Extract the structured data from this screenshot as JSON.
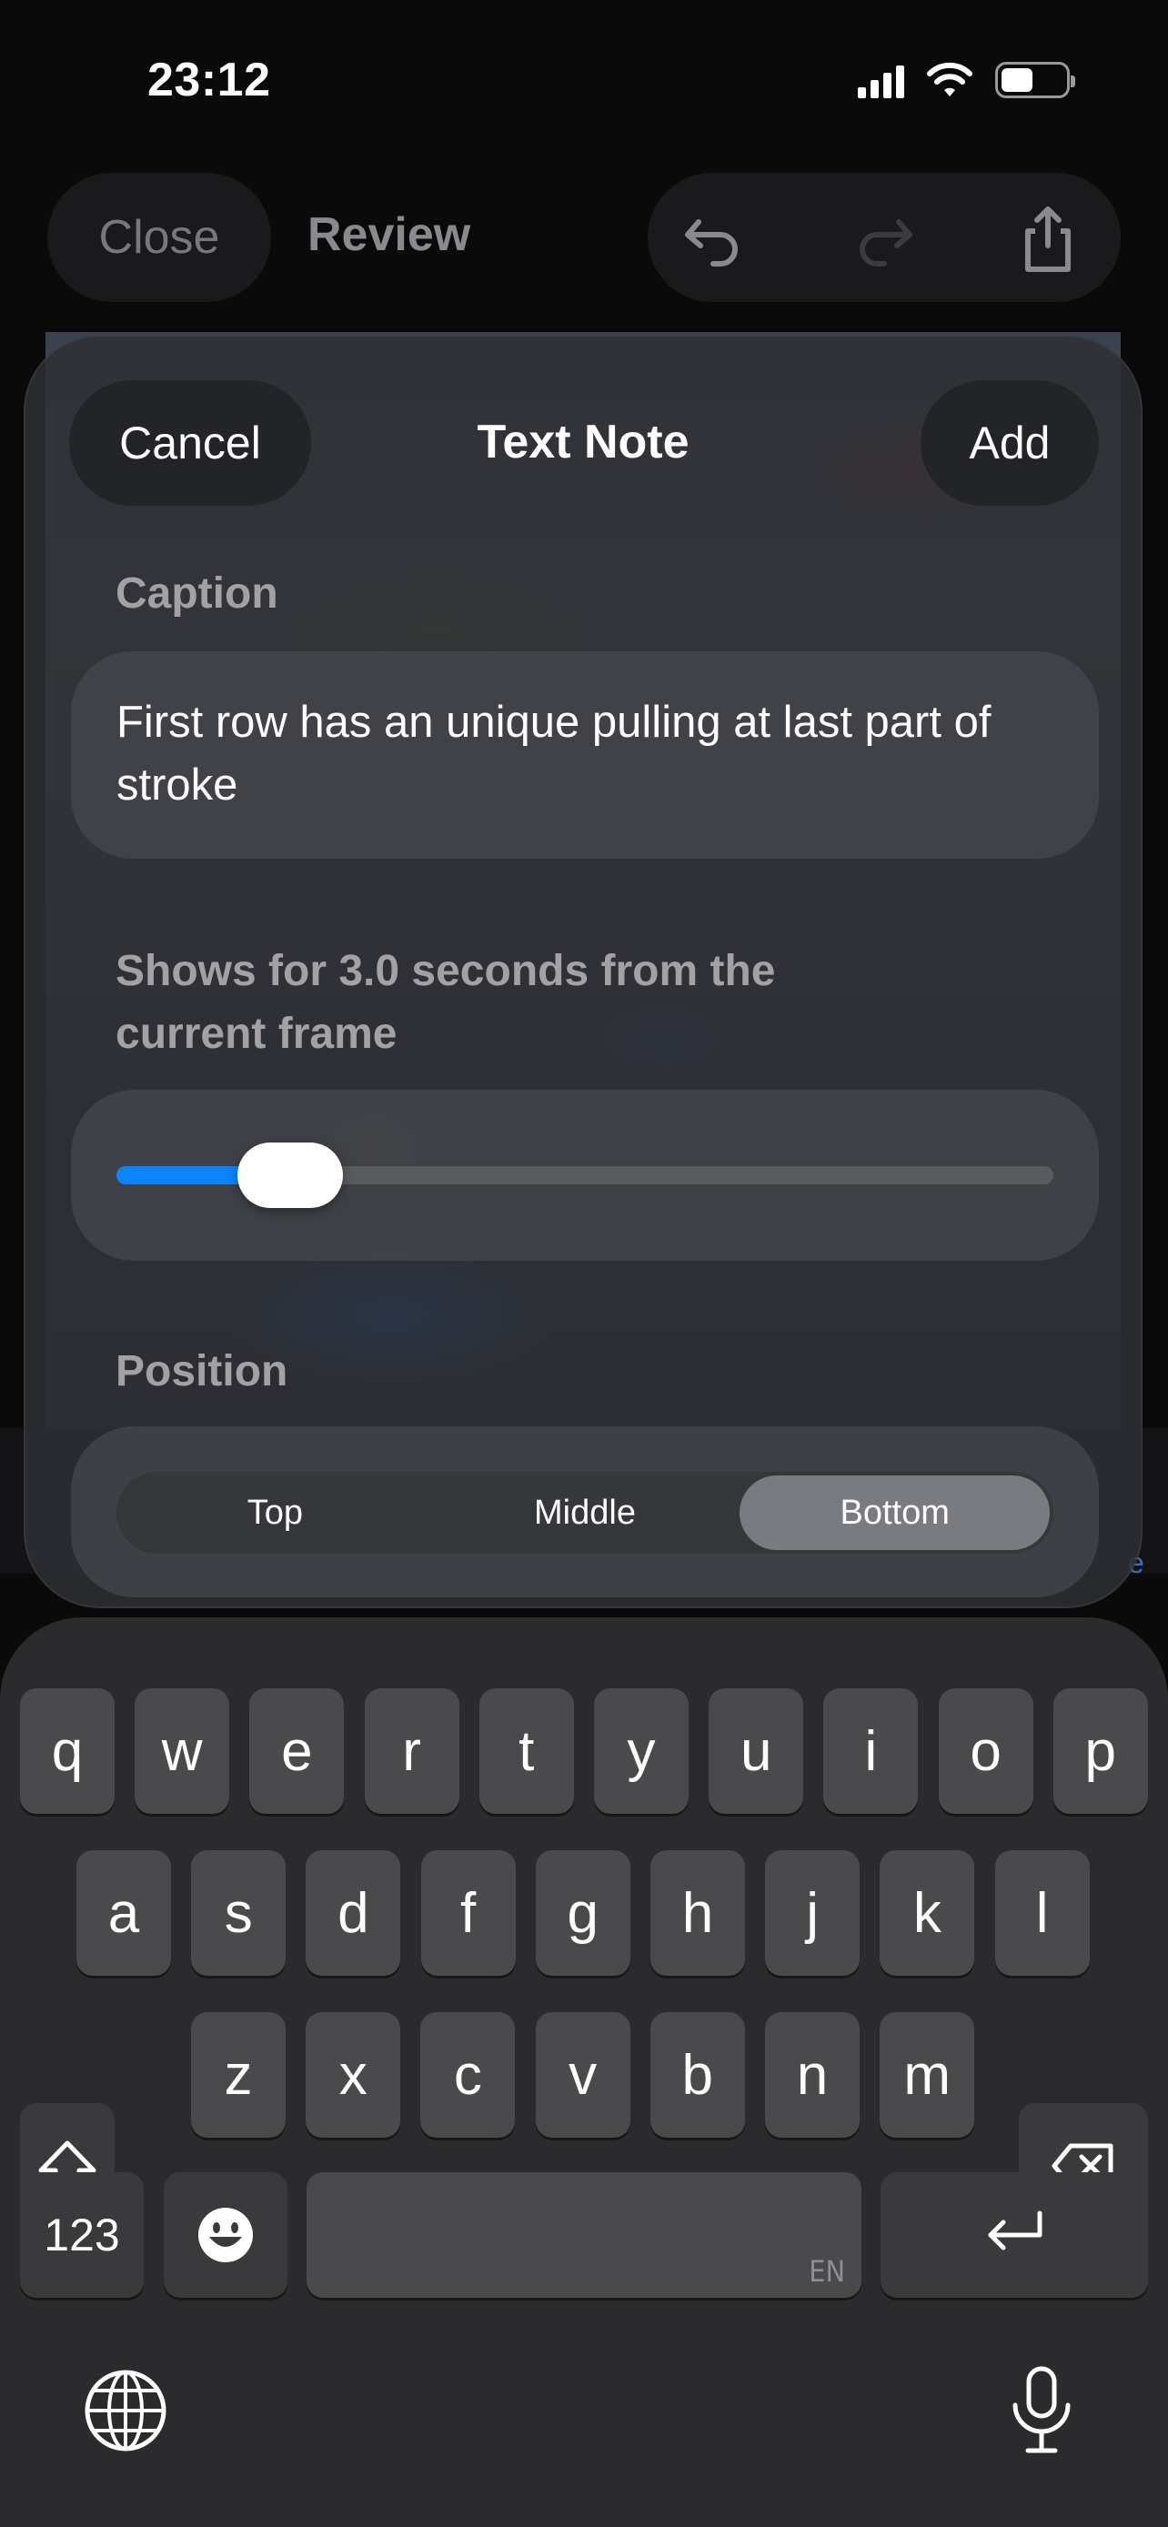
{
  "status_bar": {
    "time": "23:12",
    "icons": [
      "signal-icon",
      "wifi-icon",
      "battery-icon"
    ]
  },
  "background_app": {
    "close_label": "Close",
    "title": "Review",
    "toolbar_icons": [
      "undo-icon",
      "redo-icon",
      "share-icon"
    ],
    "edge_text": "e"
  },
  "sheet": {
    "cancel_label": "Cancel",
    "title": "Text Note",
    "add_label": "Add",
    "caption_label": "Caption",
    "caption_value": "First row has an unique pulling at last part of stroke",
    "duration_text": "Shows for 3.0 seconds from the current frame",
    "duration_slider": {
      "value_seconds": 3.0,
      "fraction": 0.185,
      "accent_color": "#0a84ff"
    },
    "position_label": "Position",
    "position_options": [
      "Top",
      "Middle",
      "Bottom"
    ],
    "position_selected": "Bottom"
  },
  "keyboard": {
    "row1": [
      "q",
      "w",
      "e",
      "r",
      "t",
      "y",
      "u",
      "i",
      "o",
      "p"
    ],
    "row2": [
      "a",
      "s",
      "d",
      "f",
      "g",
      "h",
      "j",
      "k",
      "l"
    ],
    "row3": [
      "z",
      "x",
      "c",
      "v",
      "b",
      "n",
      "m"
    ],
    "numbers_label": "123",
    "space_hint": "EN",
    "icons": [
      "shift-icon",
      "delete-icon",
      "emoji-icon",
      "return-icon",
      "globe-icon",
      "microphone-icon"
    ]
  }
}
